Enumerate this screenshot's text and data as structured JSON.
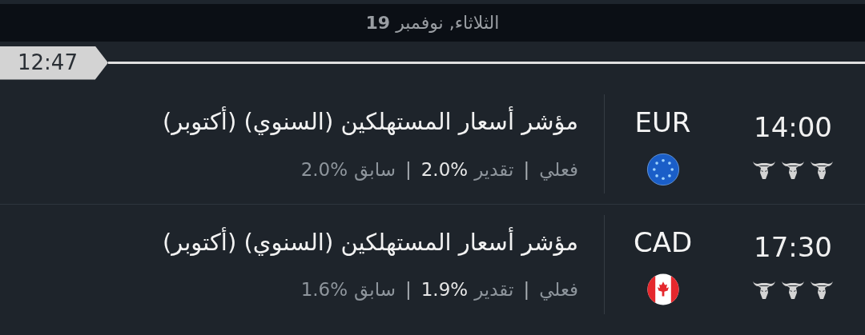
{
  "date_header": "الثلاثاء, نوفمبر **19**",
  "current_time": "12:47",
  "events": [
    {
      "title": "مؤشر أسعار المستهلكين (السنوي) (أكتوبر)",
      "currency": "EUR",
      "kind": "eu",
      "time": "14:00",
      "stars": 3,
      "details": [
        {
          "kind": "label",
          "text": "فعلي"
        },
        {
          "kind": "separator",
          "text": "|"
        },
        {
          "kind": "label",
          "text": "تقدير"
        },
        {
          "kind": "strong",
          "text": "2.0%"
        },
        {
          "kind": "separator",
          "text": "|"
        },
        {
          "kind": "label",
          "text": "سابق"
        },
        {
          "kind": "value",
          "text": "2.0%"
        }
      ]
    },
    {
      "title": "مؤشر أسعار المستهلكين (السنوي) (أكتوبر)",
      "currency": "CAD",
      "kind": "ca",
      "time": "17:30",
      "stars": 3,
      "details": [
        {
          "kind": "label",
          "text": "فعلي"
        },
        {
          "kind": "separator",
          "text": "|"
        },
        {
          "kind": "label",
          "text": "تقدير"
        },
        {
          "kind": "strong",
          "text": "1.9%"
        },
        {
          "kind": "separator",
          "text": "|"
        },
        {
          "kind": "label",
          "text": "سابق"
        },
        {
          "kind": "value",
          "text": "1.6%"
        }
      ]
    }
  ]
}
